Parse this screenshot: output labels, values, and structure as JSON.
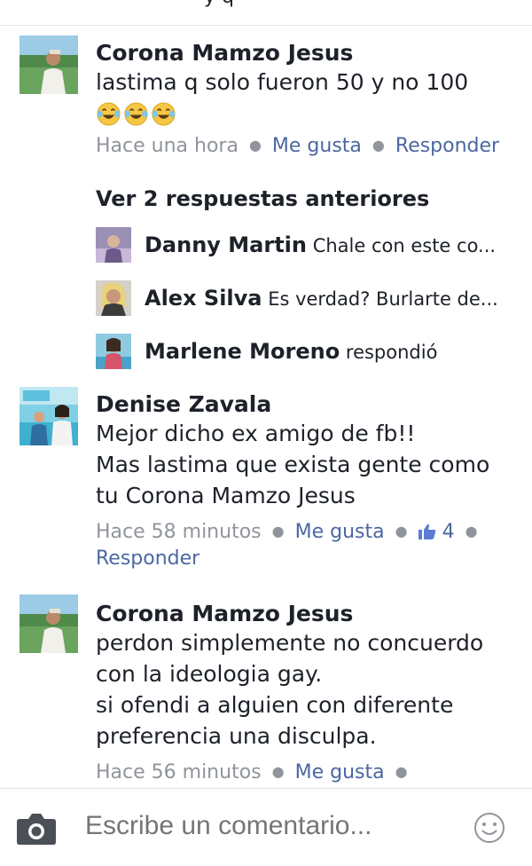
{
  "top": {
    "cut_text": "y q"
  },
  "comments": [
    {
      "author": "Corona Mamzo Jesus",
      "text_lines": [
        "lastima q solo fueron 50 y no 100"
      ],
      "emojis": [
        "laughing-tears-emoji",
        "laughing-tears-emoji",
        "laughing-tears-emoji"
      ],
      "time": "Hace una hora",
      "like_label": "Me gusta",
      "reply_label": "Responder"
    },
    {
      "author": "Denise Zavala",
      "text_lines": [
        "Mejor dicho ex amigo de fb!!",
        "Mas lastima que exista gente como",
        "tu Corona Mamzo Jesus"
      ],
      "time": "Hace 58 minutos",
      "like_label": "Me gusta",
      "like_count": "4",
      "reply_label": "Responder"
    },
    {
      "author": "Corona Mamzo Jesus",
      "text_lines": [
        "perdon simplemente no concuerdo",
        "con la ideologia gay.",
        "si ofendi a alguien con diferente",
        "preferencia una disculpa."
      ],
      "time": "Hace 56 minutos",
      "like_label": "Me gusta"
    }
  ],
  "replies_section": {
    "previous_label": "Ver 2 respuestas anteriores",
    "items": [
      {
        "name": "Danny Martin",
        "text": "Chale con este co..."
      },
      {
        "name": "Alex Silva",
        "text": "Es verdad? Burlarte de..."
      },
      {
        "name": "Marlene Moreno",
        "text": "respondió"
      }
    ]
  },
  "composer": {
    "placeholder": "Escribe un comentario..."
  },
  "colors": {
    "link": "#4b67a1",
    "meta": "#90949c",
    "text": "#1d2129"
  }
}
